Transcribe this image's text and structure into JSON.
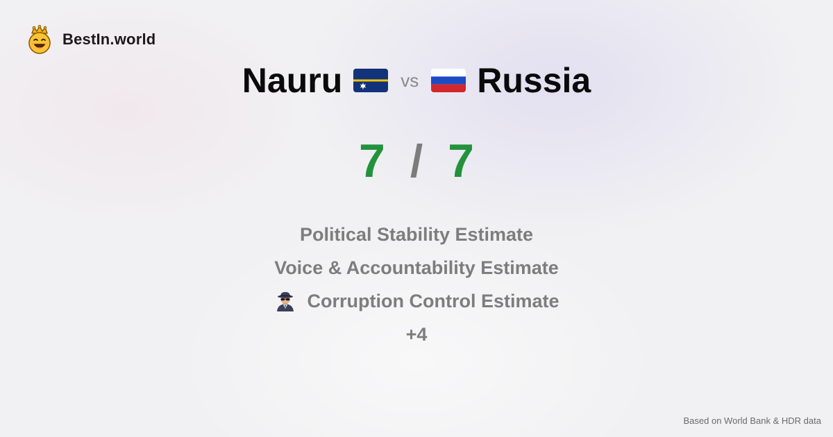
{
  "brand": {
    "name": "BestIn.world",
    "icon": "crown-smiley-icon"
  },
  "comparison": {
    "left_country": "Nauru",
    "left_flag": "nauru-flag-icon",
    "vs_label": "vs",
    "right_country": "Russia",
    "right_flag": "russia-flag-icon"
  },
  "score": {
    "left": "7",
    "separator": "/",
    "right": "7",
    "color": "#23923d"
  },
  "metrics": {
    "item_1": "Political Stability Estimate",
    "item_2": "Voice & Accountability Estimate",
    "item_3": "Corruption Control Estimate",
    "item_3_icon": "detective-icon",
    "more": "+4"
  },
  "footer": {
    "source": "Based on World Bank & HDR data"
  }
}
